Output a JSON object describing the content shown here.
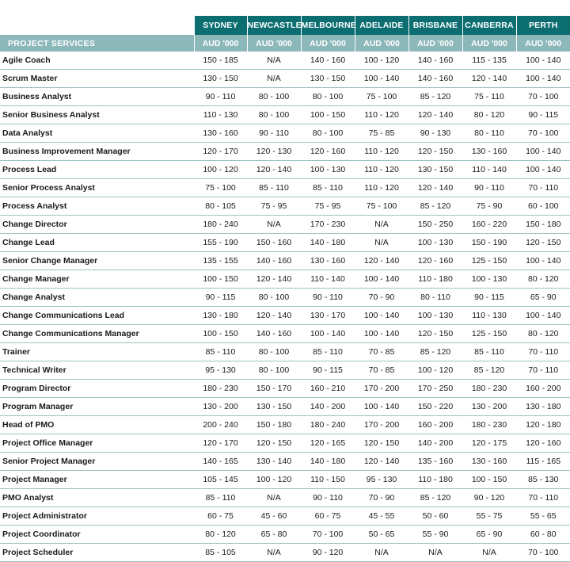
{
  "table": {
    "cities": [
      "SYDNEY",
      "NEWCASTLE",
      "MELBOURNE",
      "ADELAIDE",
      "BRISBANE",
      "CANBERRA",
      "PERTH"
    ],
    "section_label": "PROJECT SERVICES",
    "unit_label": "AUD '000",
    "rows": [
      {
        "role": "Agile Coach",
        "values": [
          "150 - 185",
          "N/A",
          "140 - 160",
          "100 - 120",
          "140 - 160",
          "115 - 135",
          "100 - 140"
        ]
      },
      {
        "role": "Scrum Master",
        "values": [
          "130 - 150",
          "N/A",
          "130 - 150",
          "100 - 140",
          "140 - 160",
          "120 - 140",
          "100 - 140"
        ]
      },
      {
        "role": "Business Analyst",
        "values": [
          "90 - 110",
          "80 - 100",
          "80 - 100",
          "75 - 100",
          "85 - 120",
          "75 - 110",
          "70 - 100"
        ]
      },
      {
        "role": "Senior Business Analyst",
        "values": [
          "110 - 130",
          "80 - 100",
          "100 - 150",
          "110 - 120",
          "120 - 140",
          "80 - 120",
          "90 - 115"
        ]
      },
      {
        "role": "Data Analyst",
        "values": [
          "130 - 160",
          "90 - 110",
          "80 - 100",
          "75 - 85",
          "90 - 130",
          "80 - 110",
          "70 - 100"
        ]
      },
      {
        "role": "Business Improvement Manager",
        "values": [
          "120 - 170",
          "120 - 130",
          "120 - 160",
          "110 - 120",
          "120 - 150",
          "130 - 160",
          "100 - 140"
        ]
      },
      {
        "role": "Process Lead",
        "values": [
          "100 - 120",
          "120 - 140",
          "100 - 130",
          "110 - 120",
          "130 - 150",
          "110 - 140",
          "100 - 140"
        ]
      },
      {
        "role": "Senior Process Analyst",
        "values": [
          "75 - 100",
          "85 - 110",
          "85 - 110",
          "110 - 120",
          "120 - 140",
          "90 - 110",
          "70 - 110"
        ]
      },
      {
        "role": "Process Analyst",
        "values": [
          "80 - 105",
          "75 - 95",
          "75 - 95",
          "75 - 100",
          "85 - 120",
          "75 - 90",
          "60 - 100"
        ]
      },
      {
        "role": "Change Director",
        "values": [
          "180 - 240",
          "N/A",
          "170 - 230",
          "N/A",
          "150 - 250",
          "160 - 220",
          "150 - 180"
        ]
      },
      {
        "role": "Change Lead",
        "values": [
          "155 - 190",
          "150 - 160",
          "140 - 180",
          "N/A",
          "100 - 130",
          "150 - 190",
          "120 - 150"
        ]
      },
      {
        "role": "Senior Change Manager",
        "values": [
          "135 - 155",
          "140 - 160",
          "130 - 160",
          "120 - 140",
          "120 - 160",
          "125 - 150",
          "100 - 140"
        ]
      },
      {
        "role": "Change Manager",
        "values": [
          "100 - 150",
          "120 - 140",
          "110 - 140",
          "100 - 140",
          "110 - 180",
          "100 - 130",
          "80 - 120"
        ]
      },
      {
        "role": "Change Analyst",
        "values": [
          "90 - 115",
          "80 - 100",
          "90 - 110",
          "70 - 90",
          "80 - 110",
          "90 - 115",
          "65 - 90"
        ]
      },
      {
        "role": "Change Communications Lead",
        "values": [
          "130 - 180",
          "120 - 140",
          "130 - 170",
          "100 - 140",
          "100 - 130",
          "110 - 130",
          "100 - 140"
        ]
      },
      {
        "role": "Change Communications Manager",
        "values": [
          "100 - 150",
          "140 - 160",
          "100 - 140",
          "100 - 140",
          "120 - 150",
          "125 - 150",
          "80 - 120"
        ]
      },
      {
        "role": "Trainer",
        "values": [
          "85 - 110",
          "80 - 100",
          "85 - 110",
          "70 - 85",
          "85 - 120",
          "85 - 110",
          "70 - 110"
        ]
      },
      {
        "role": "Technical Writer",
        "values": [
          "95 - 130",
          "80 - 100",
          "90 - 115",
          "70 - 85",
          "100 - 120",
          "85 - 120",
          "70 - 110"
        ]
      },
      {
        "role": "Program Director",
        "values": [
          "180 - 230",
          "150 - 170",
          "160 - 210",
          "170 - 200",
          "170 - 250",
          "180 - 230",
          "160 - 200"
        ]
      },
      {
        "role": "Program Manager",
        "values": [
          "130 - 200",
          "130 - 150",
          "140 - 200",
          "100 - 140",
          "150 - 220",
          "130 - 200",
          "130 - 180"
        ]
      },
      {
        "role": "Head of PMO",
        "values": [
          "200 - 240",
          "150 - 180",
          "180 - 240",
          "170 - 200",
          "160 - 200",
          "180 - 230",
          "120 - 180"
        ]
      },
      {
        "role": "Project Office Manager",
        "values": [
          "120 - 170",
          "120 - 150",
          "120 - 165",
          "120 - 150",
          "140 - 200",
          "120 - 175",
          "120 - 160"
        ]
      },
      {
        "role": "Senior Project Manager",
        "values": [
          "140 - 165",
          "130 - 140",
          "140 - 180",
          "120 - 140",
          "135 - 160",
          "130 - 160",
          "115 - 165"
        ]
      },
      {
        "role": "Project Manager",
        "values": [
          "105 - 145",
          "100 - 120",
          "110 - 150",
          "95 - 130",
          "110 - 180",
          "100 - 150",
          "85 - 130"
        ]
      },
      {
        "role": "PMO Analyst",
        "values": [
          "85 - 110",
          "N/A",
          "90 - 110",
          "70 - 90",
          "85 - 120",
          "90 - 120",
          "70 - 110"
        ]
      },
      {
        "role": "Project Administrator",
        "values": [
          "60 - 75",
          "45 - 60",
          "60 - 75",
          "45 - 55",
          "50 - 60",
          "55 - 75",
          "55 - 65"
        ]
      },
      {
        "role": "Project Coordinator",
        "values": [
          "80 - 120",
          "65 - 80",
          "70 - 100",
          "50 - 65",
          "55 - 90",
          "65 - 90",
          "60 - 80"
        ]
      },
      {
        "role": "Project Scheduler",
        "values": [
          "85 - 105",
          "N/A",
          "90 - 120",
          "N/A",
          "N/A",
          "N/A",
          "70 - 100"
        ]
      }
    ]
  }
}
